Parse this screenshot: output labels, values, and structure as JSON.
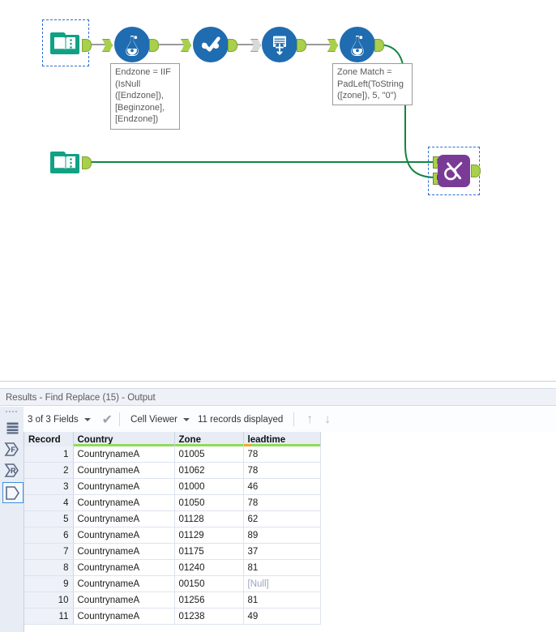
{
  "canvas": {
    "tools": [
      {
        "name": "input-data-top",
        "type": "input-data",
        "label": "Input Data",
        "selected": true
      },
      {
        "name": "formula-endzone",
        "type": "formula",
        "label": "Formula"
      },
      {
        "name": "select-tool",
        "type": "select",
        "label": "Select"
      },
      {
        "name": "union-tool",
        "type": "union",
        "label": "Union"
      },
      {
        "name": "formula-zonematch",
        "type": "formula",
        "label": "Formula"
      },
      {
        "name": "input-data-bottom",
        "type": "input-data",
        "label": "Input Data",
        "selected": false
      },
      {
        "name": "find-replace-tool",
        "type": "find-replace",
        "label": "Find Replace",
        "selected": true
      }
    ],
    "annotations": [
      {
        "name": "annotation-endzone",
        "text": "Endzone = IIF\n(IsNull\n([Endzone]),\n[Beginzone],\n[Endzone])"
      },
      {
        "name": "annotation-zonematch",
        "text": "Zone Match =\nPadLeft(ToString\n([zone]), 5, \"0\")"
      }
    ],
    "anchor_labels": {
      "find": "F",
      "replace": "R"
    },
    "colors": {
      "tool_blue": "#1f6cb0",
      "tool_teal": "#11a184",
      "tool_purple": "#7a3b96",
      "anchor_green": "#a8d04a",
      "wire_green": "#12853f",
      "wire_grey": "#9a9a9a",
      "selection_blue": "#2a6dd1"
    }
  },
  "results": {
    "title": "Results - Find Replace (15) - Output",
    "toolbar": {
      "fields_label": "3 of 3 Fields",
      "check_icon": "✔",
      "view_label": "Cell Viewer",
      "records_label": "11 records displayed",
      "up_icon": "↑",
      "down_icon": "↓"
    },
    "sidebar": [
      {
        "name": "sidebar-data-icon",
        "icon": "table-icon",
        "selected": false
      },
      {
        "name": "sidebar-anchor-f",
        "icon": "anchor-f-icon",
        "label": "F",
        "selected": false
      },
      {
        "name": "sidebar-anchor-r",
        "icon": "anchor-r-icon",
        "label": "R",
        "selected": false
      },
      {
        "name": "sidebar-anchor-output",
        "icon": "anchor-output-icon",
        "label": "",
        "selected": true
      }
    ],
    "table": {
      "columns": [
        "Record",
        "Country",
        "Zone",
        "leadtime"
      ],
      "rows": [
        {
          "record": "1",
          "country": "CountrynameA",
          "zone": "01005",
          "leadtime": "78"
        },
        {
          "record": "2",
          "country": "CountrynameA",
          "zone": "01062",
          "leadtime": "78"
        },
        {
          "record": "3",
          "country": "CountrynameA",
          "zone": "01000",
          "leadtime": "46"
        },
        {
          "record": "4",
          "country": "CountrynameA",
          "zone": "01050",
          "leadtime": "78"
        },
        {
          "record": "5",
          "country": "CountrynameA",
          "zone": "01128",
          "leadtime": "62"
        },
        {
          "record": "6",
          "country": "CountrynameA",
          "zone": "01129",
          "leadtime": "89"
        },
        {
          "record": "7",
          "country": "CountrynameA",
          "zone": "01175",
          "leadtime": "37"
        },
        {
          "record": "8",
          "country": "CountrynameA",
          "zone": "01240",
          "leadtime": "81"
        },
        {
          "record": "9",
          "country": "CountrynameA",
          "zone": "00150",
          "leadtime": "[Null]"
        },
        {
          "record": "10",
          "country": "CountrynameA",
          "zone": "01256",
          "leadtime": "81"
        },
        {
          "record": "11",
          "country": "CountrynameA",
          "zone": "01238",
          "leadtime": "49"
        }
      ],
      "null_token": "[Null]"
    }
  }
}
